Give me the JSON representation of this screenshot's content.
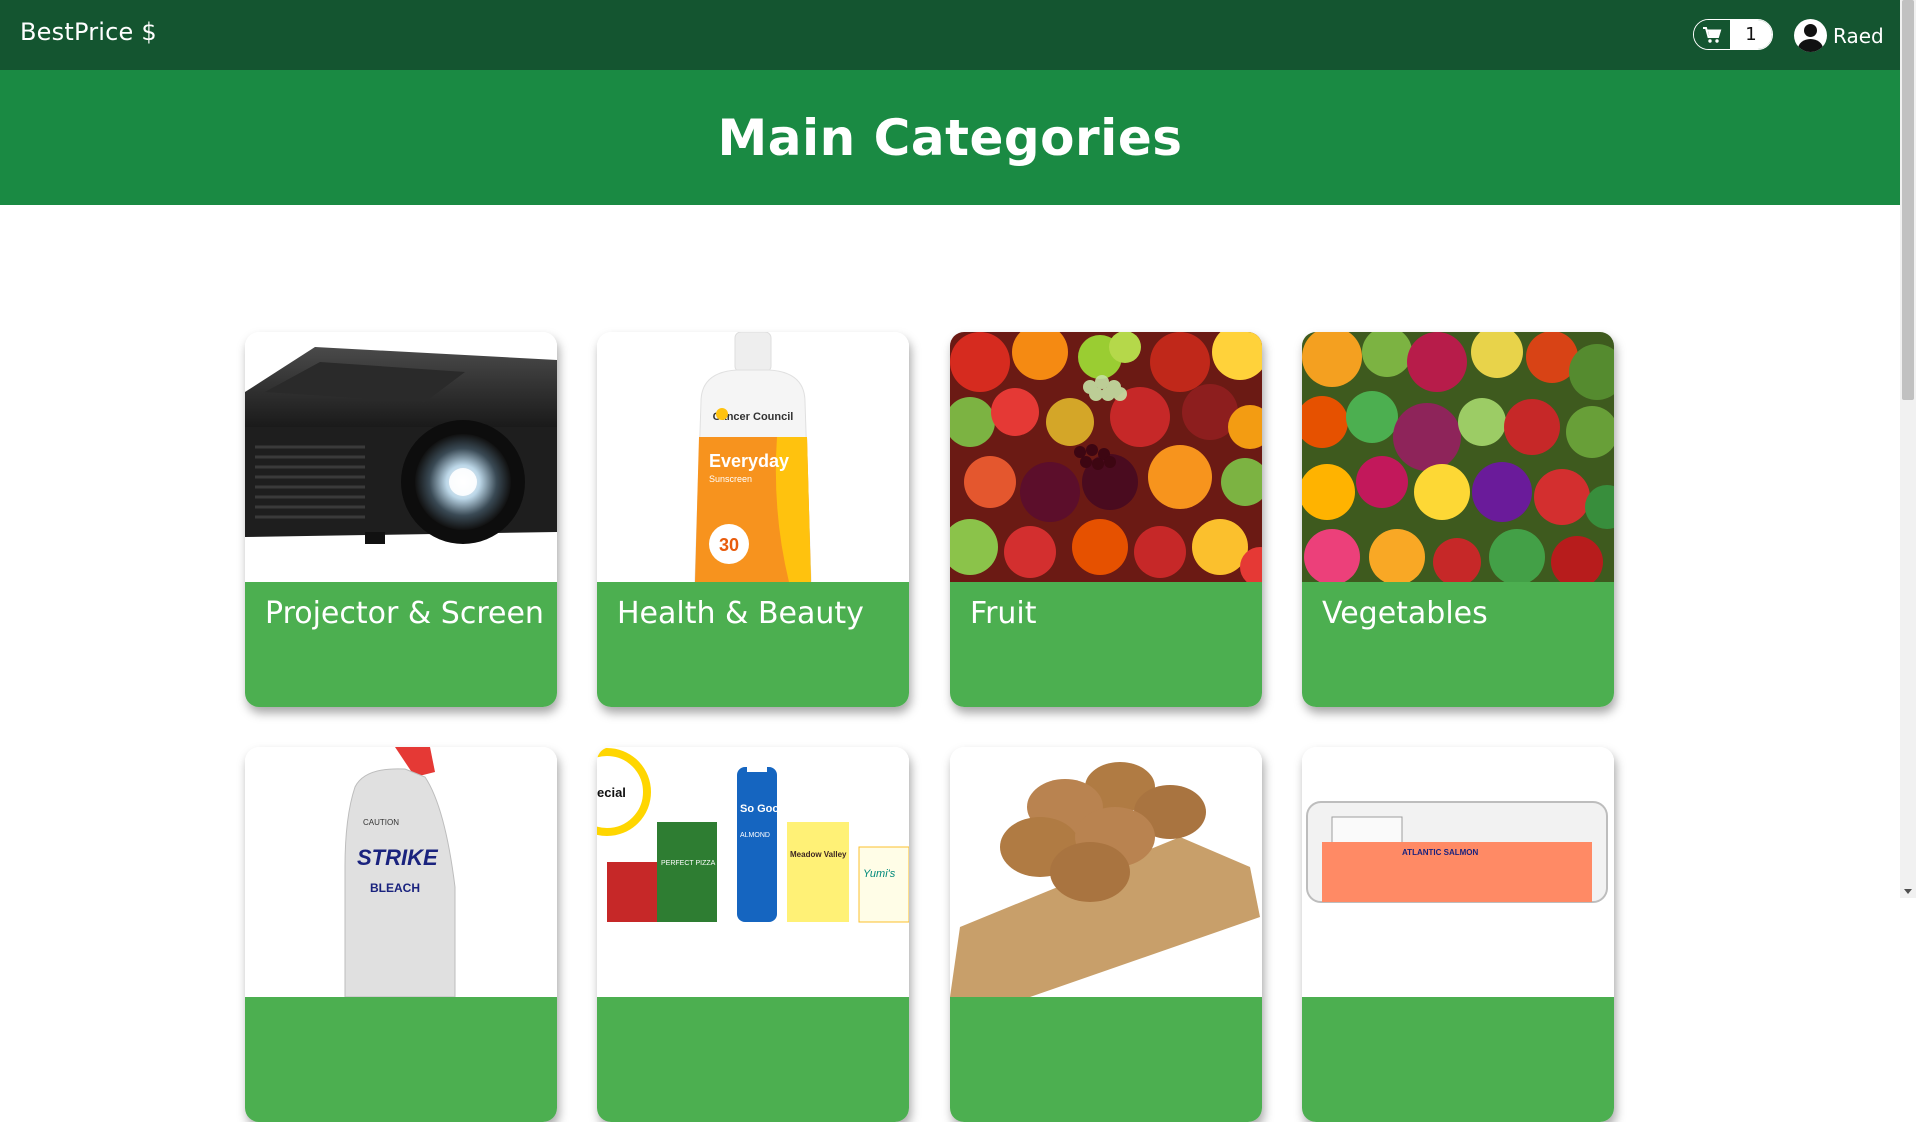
{
  "nav": {
    "brand": "BestPrice $",
    "cart_count": "1",
    "user_name": "Raed"
  },
  "hero": {
    "title": "Main Categories"
  },
  "categories": [
    {
      "label": "Projector & Screen",
      "image": "projector"
    },
    {
      "label": "Health & Beauty",
      "image": "sunscreen-bottle"
    },
    {
      "label": "Fruit",
      "image": "fruit-assortment"
    },
    {
      "label": "Vegetables",
      "image": "vegetable-assortment"
    },
    {
      "label": "",
      "image": "bleach-bottle"
    },
    {
      "label": "",
      "image": "grocery-products"
    },
    {
      "label": "",
      "image": "bread-rolls"
    },
    {
      "label": "",
      "image": "salmon-pack"
    }
  ],
  "product_text": {
    "sunscreen_brand": "Cancer Council",
    "sunscreen_name": "Everyday",
    "sunscreen_sub": "Sunscreen",
    "sunscreen_spf": "30",
    "bleach_brand": "STRIKE",
    "bleach_caution": "CAUTION",
    "bleach_word": "BLEACH",
    "pizza_text": "PERFECT PIZZA",
    "milk_text": "So Good",
    "milk_sub": "ALMOND",
    "cheese_text": "Meadow Valley",
    "yogurt_text": "Yumi's",
    "special_text": "ecial",
    "salmon_text": "ATLANTIC SALMON"
  },
  "colors": {
    "navbar": "#145530",
    "hero": "#1a8a43",
    "card_label": "#4caf50"
  }
}
